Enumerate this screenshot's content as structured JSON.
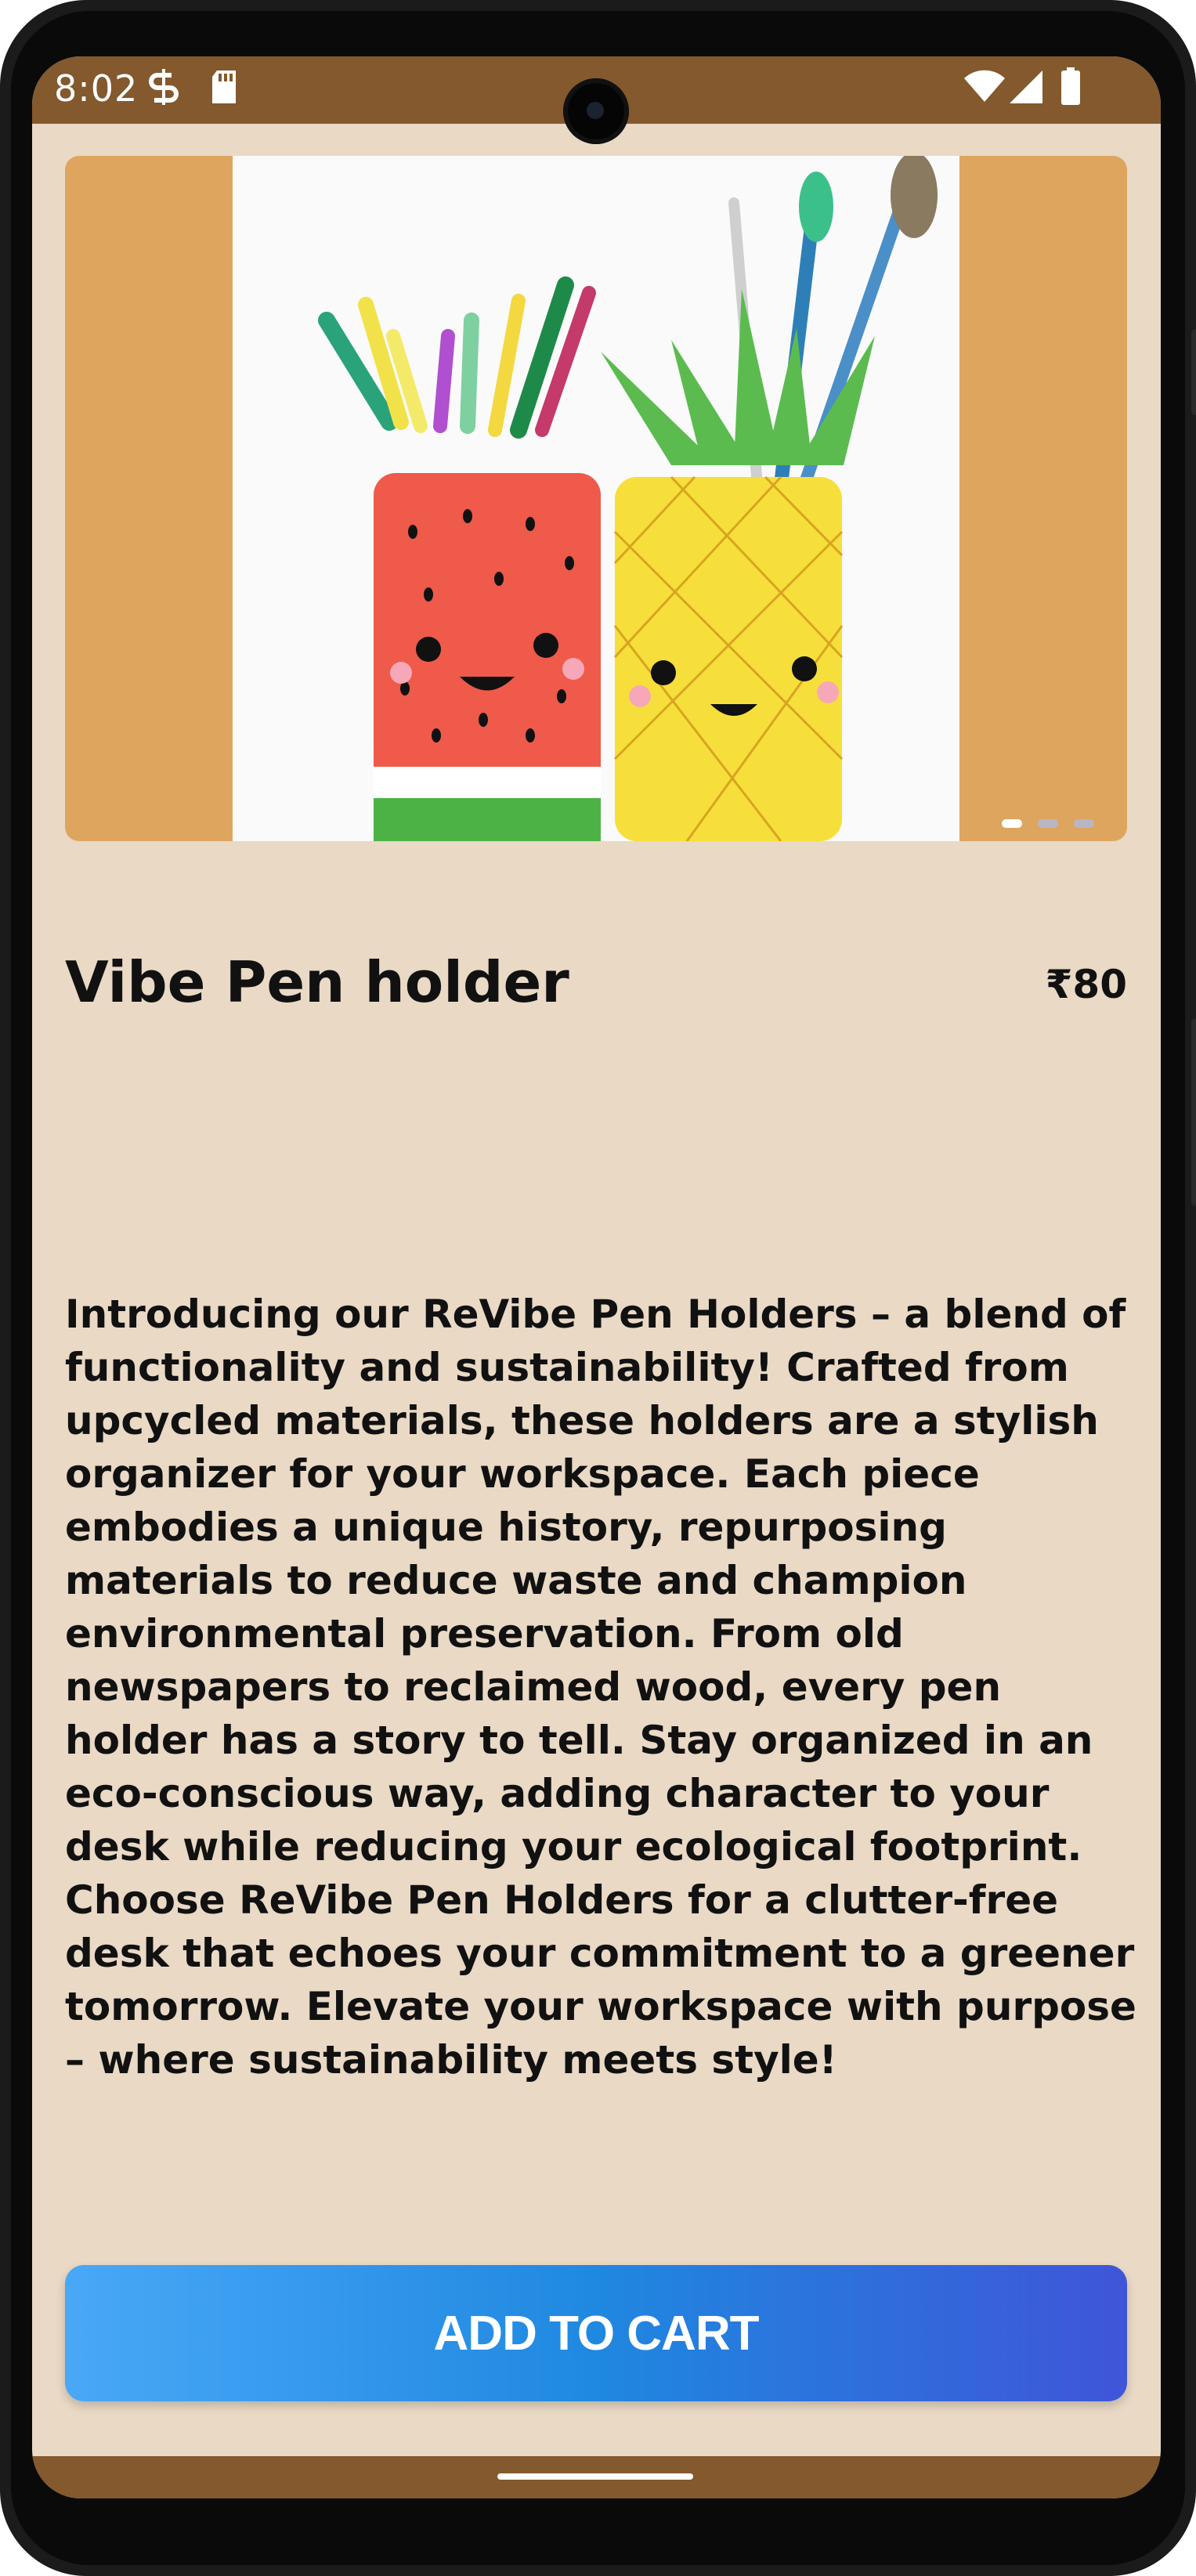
{
  "status_bar": {
    "time": "8:02",
    "left_icons": [
      "vpn-s-icon",
      "sd-card-icon"
    ],
    "right_icons": [
      "wifi-icon",
      "cellular-signal-icon",
      "battery-icon"
    ],
    "background": "#83592d"
  },
  "product": {
    "image_description_icon": "product-image",
    "carousel": {
      "pages": 3,
      "active_index": 0
    },
    "title": "Vibe Pen holder",
    "price": "₹80",
    "description": "Introducing our ReVibe Pen Holders – a blend of functionality and sustainability! Crafted from upcycled materials, these holders are a stylish organizer for your workspace. Each piece embodies a unique history, repurposing materials to reduce waste and champion environmental preservation. From old newspapers to reclaimed wood, every pen holder has a story to tell. Stay organized in an eco-conscious way, adding character to your desk while reducing your ecological footprint. Choose ReVibe Pen Holders for a clutter-free desk that echoes your commitment to a greener tomorrow. Elevate your workspace with purpose – where sustainability meets style!"
  },
  "actions": {
    "add_to_cart_label": "ADD TO CART"
  },
  "colors": {
    "page_background": "#e9d9c5",
    "hero_background": "#dea55f",
    "button_gradient_start": "#49a8f7",
    "button_gradient_end": "#3f55d8",
    "bars": "#83592d"
  }
}
